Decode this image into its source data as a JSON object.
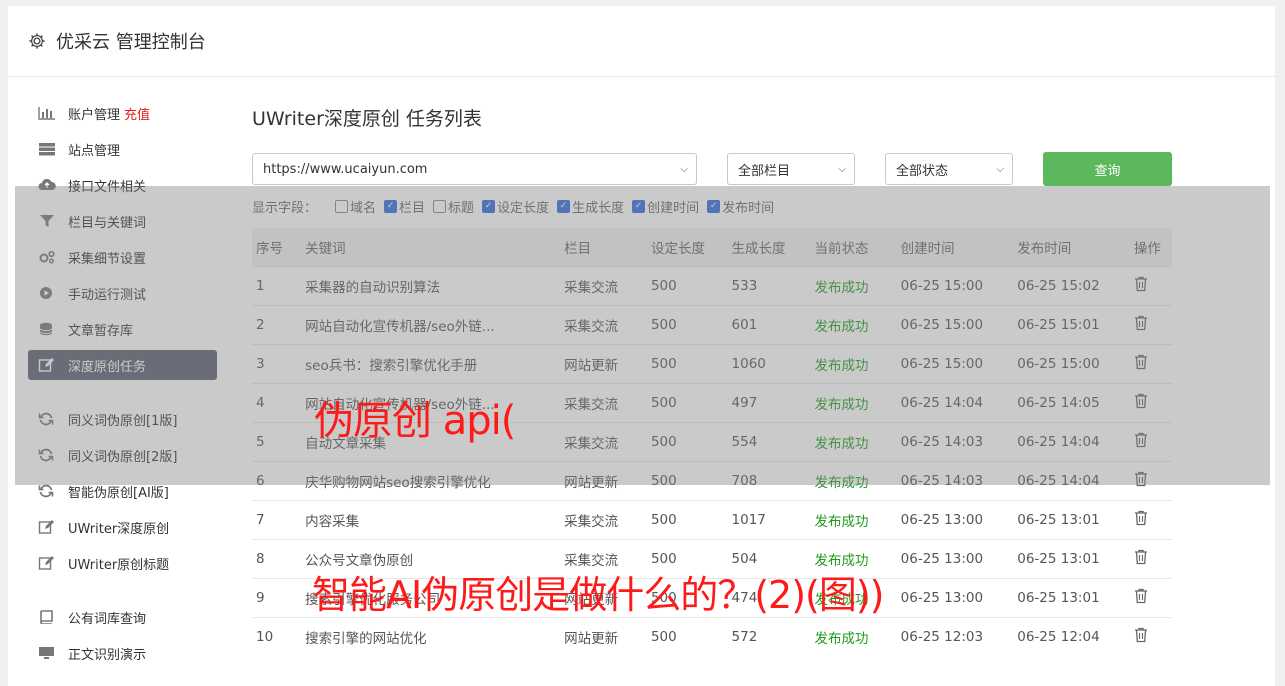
{
  "header": {
    "title": "优采云 管理控制台",
    "icon": "gear-icon"
  },
  "sidebar": {
    "group1": [
      {
        "label": "账户管理",
        "badge": "充值",
        "icon": "bar-chart-icon"
      },
      {
        "label": "站点管理",
        "icon": "server-icon"
      },
      {
        "label": "接口文件相关",
        "icon": "cloud-upload-icon"
      },
      {
        "label": "栏目与关键词",
        "icon": "filter-icon"
      },
      {
        "label": "采集细节设置",
        "icon": "cogs-icon"
      },
      {
        "label": "手动运行测试",
        "icon": "play-circle-icon"
      },
      {
        "label": "文章暂存库",
        "icon": "database-icon"
      },
      {
        "label": "深度原创任务",
        "icon": "edit-icon",
        "active": true
      }
    ],
    "group2": [
      {
        "label": "同义词伪原创[1版]",
        "icon": "refresh-icon"
      },
      {
        "label": "同义词伪原创[2版]",
        "icon": "refresh-icon"
      },
      {
        "label": "智能伪原创[AI版]",
        "icon": "refresh-icon"
      },
      {
        "label": "UWriter深度原创",
        "icon": "edit-icon"
      },
      {
        "label": "UWriter原创标题",
        "icon": "edit-icon"
      }
    ],
    "group3": [
      {
        "label": "公有词库查询",
        "icon": "book-icon"
      },
      {
        "label": "正文识别演示",
        "icon": "monitor-icon"
      }
    ]
  },
  "main": {
    "title": "UWriter深度原创 任务列表",
    "site_select": "https://www.ucaiyun.com",
    "column_select": "全部栏目",
    "status_select": "全部状态",
    "query_button": "查询",
    "fields_label": "显示字段：",
    "fields": [
      {
        "label": "域名",
        "checked": false
      },
      {
        "label": "栏目",
        "checked": true
      },
      {
        "label": "标题",
        "checked": false
      },
      {
        "label": "设定长度",
        "checked": true
      },
      {
        "label": "生成长度",
        "checked": true
      },
      {
        "label": "创建时间",
        "checked": true
      },
      {
        "label": "发布时间",
        "checked": true
      }
    ],
    "columns": [
      "序号",
      "关键词",
      "栏目",
      "设定长度",
      "生成长度",
      "当前状态",
      "创建时间",
      "发布时间",
      "操作"
    ],
    "rows": [
      [
        "1",
        "采集器的自动识别算法",
        "采集交流",
        "500",
        "533",
        "发布成功",
        "06-25 15:00",
        "06-25 15:02"
      ],
      [
        "2",
        "网站自动化宣传机器/seo外链...",
        "采集交流",
        "500",
        "601",
        "发布成功",
        "06-25 15:00",
        "06-25 15:01"
      ],
      [
        "3",
        "seo兵书：搜索引擎优化手册",
        "网站更新",
        "500",
        "1060",
        "发布成功",
        "06-25 15:00",
        "06-25 15:00"
      ],
      [
        "4",
        "网站自动化宣传机器/seo外链...",
        "采集交流",
        "500",
        "497",
        "发布成功",
        "06-25 14:04",
        "06-25 14:05"
      ],
      [
        "5",
        "自动文章采集",
        "采集交流",
        "500",
        "554",
        "发布成功",
        "06-25 14:03",
        "06-25 14:04"
      ],
      [
        "6",
        "庆华购物网站seo搜索引擎优化",
        "网站更新",
        "500",
        "708",
        "发布成功",
        "06-25 14:03",
        "06-25 14:04"
      ],
      [
        "7",
        "内容采集",
        "采集交流",
        "500",
        "1017",
        "发布成功",
        "06-25 13:00",
        "06-25 13:01"
      ],
      [
        "8",
        "公众号文章伪原创",
        "采集交流",
        "500",
        "504",
        "发布成功",
        "06-25 13:00",
        "06-25 13:01"
      ],
      [
        "9",
        "搜索引擎优化服务公司",
        "网站更新",
        "500",
        "474",
        "发布成功",
        "06-25 13:00",
        "06-25 13:01"
      ],
      [
        "10",
        "搜索引擎的网站优化",
        "网站更新",
        "500",
        "572",
        "发布成功",
        "06-25 12:03",
        "06-25 12:04"
      ]
    ]
  },
  "watermark": {
    "line1": "伪原创 api(",
    "line2": "智能AI伪原创是做什么的？(2)(图))"
  }
}
